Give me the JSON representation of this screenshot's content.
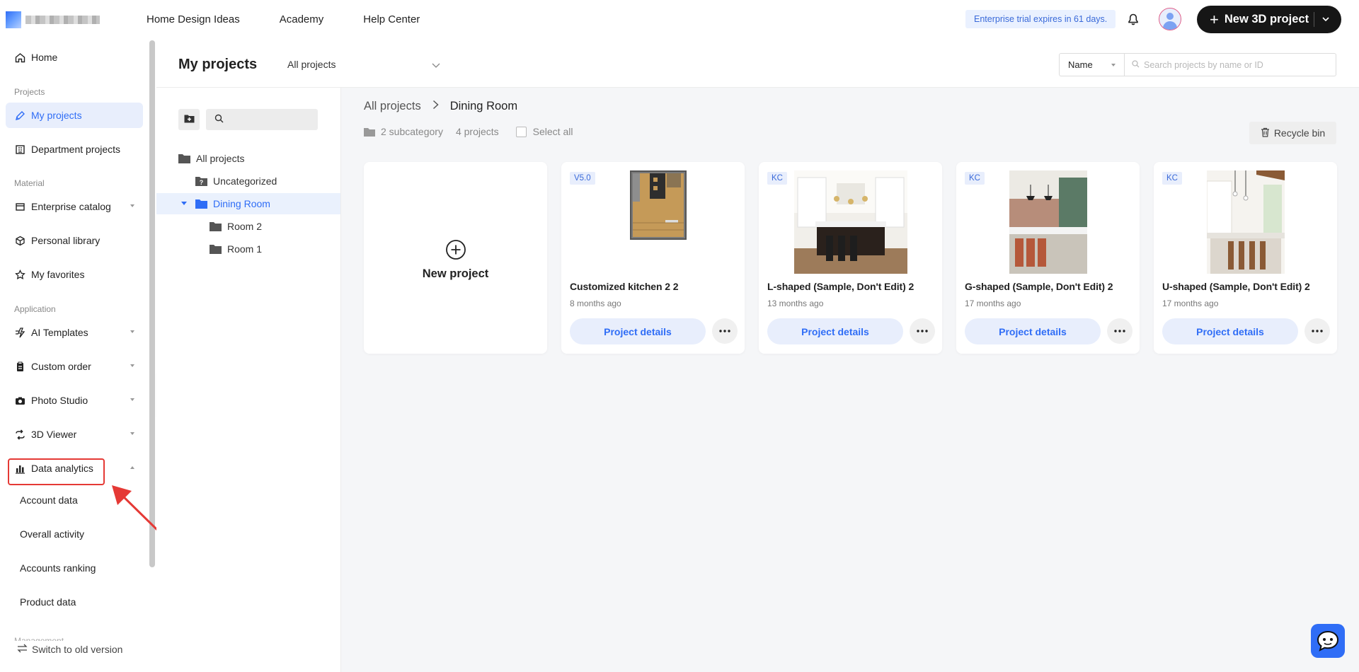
{
  "topbar": {
    "nav": [
      "Home Design Ideas",
      "Academy",
      "Help Center"
    ],
    "trial_text": "Enterprise trial expires in 61 days.",
    "new_3d_label": "New 3D project"
  },
  "sidebar": {
    "home": "Home",
    "section_projects": "Projects",
    "my_projects": "My projects",
    "department_projects": "Department projects",
    "section_material": "Material",
    "enterprise_catalog": "Enterprise catalog",
    "personal_library": "Personal library",
    "my_favorites": "My favorites",
    "section_application": "Application",
    "ai_templates": "AI Templates",
    "custom_order": "Custom order",
    "photo_studio": "Photo Studio",
    "viewer_3d": "3D Viewer",
    "data_analytics": "Data analytics",
    "analytics_sub": [
      "Account data",
      "Overall activity",
      "Accounts ranking",
      "Product data"
    ],
    "section_management": "Management",
    "switch_old": "Switch to old version"
  },
  "header": {
    "title": "My projects",
    "scope": "All projects",
    "sort": "Name",
    "search_placeholder": "Search projects by name or ID"
  },
  "tree": {
    "all": "All projects",
    "uncategorized": "Uncategorized",
    "dining": "Dining Room",
    "room2": "Room 2",
    "room1": "Room 1"
  },
  "content": {
    "crumb_root": "All projects",
    "crumb_current": "Dining Room",
    "subcat": "2 subcategory",
    "projects_count": "4 projects",
    "select_all": "Select all",
    "recycle": "Recycle bin",
    "new_project": "New project",
    "details_label": "Project details",
    "projects": [
      {
        "tag": "V5.0",
        "name": "Customized kitchen 2 2",
        "time": "8 months ago"
      },
      {
        "tag": "KC",
        "name": "L-shaped (Sample, Don't Edit) 2",
        "time": "13 months ago"
      },
      {
        "tag": "KC",
        "name": "G-shaped (Sample, Don't Edit) 2",
        "time": "17 months ago"
      },
      {
        "tag": "KC",
        "name": "U-shaped (Sample, Don't Edit) 2",
        "time": "17 months ago"
      }
    ]
  }
}
